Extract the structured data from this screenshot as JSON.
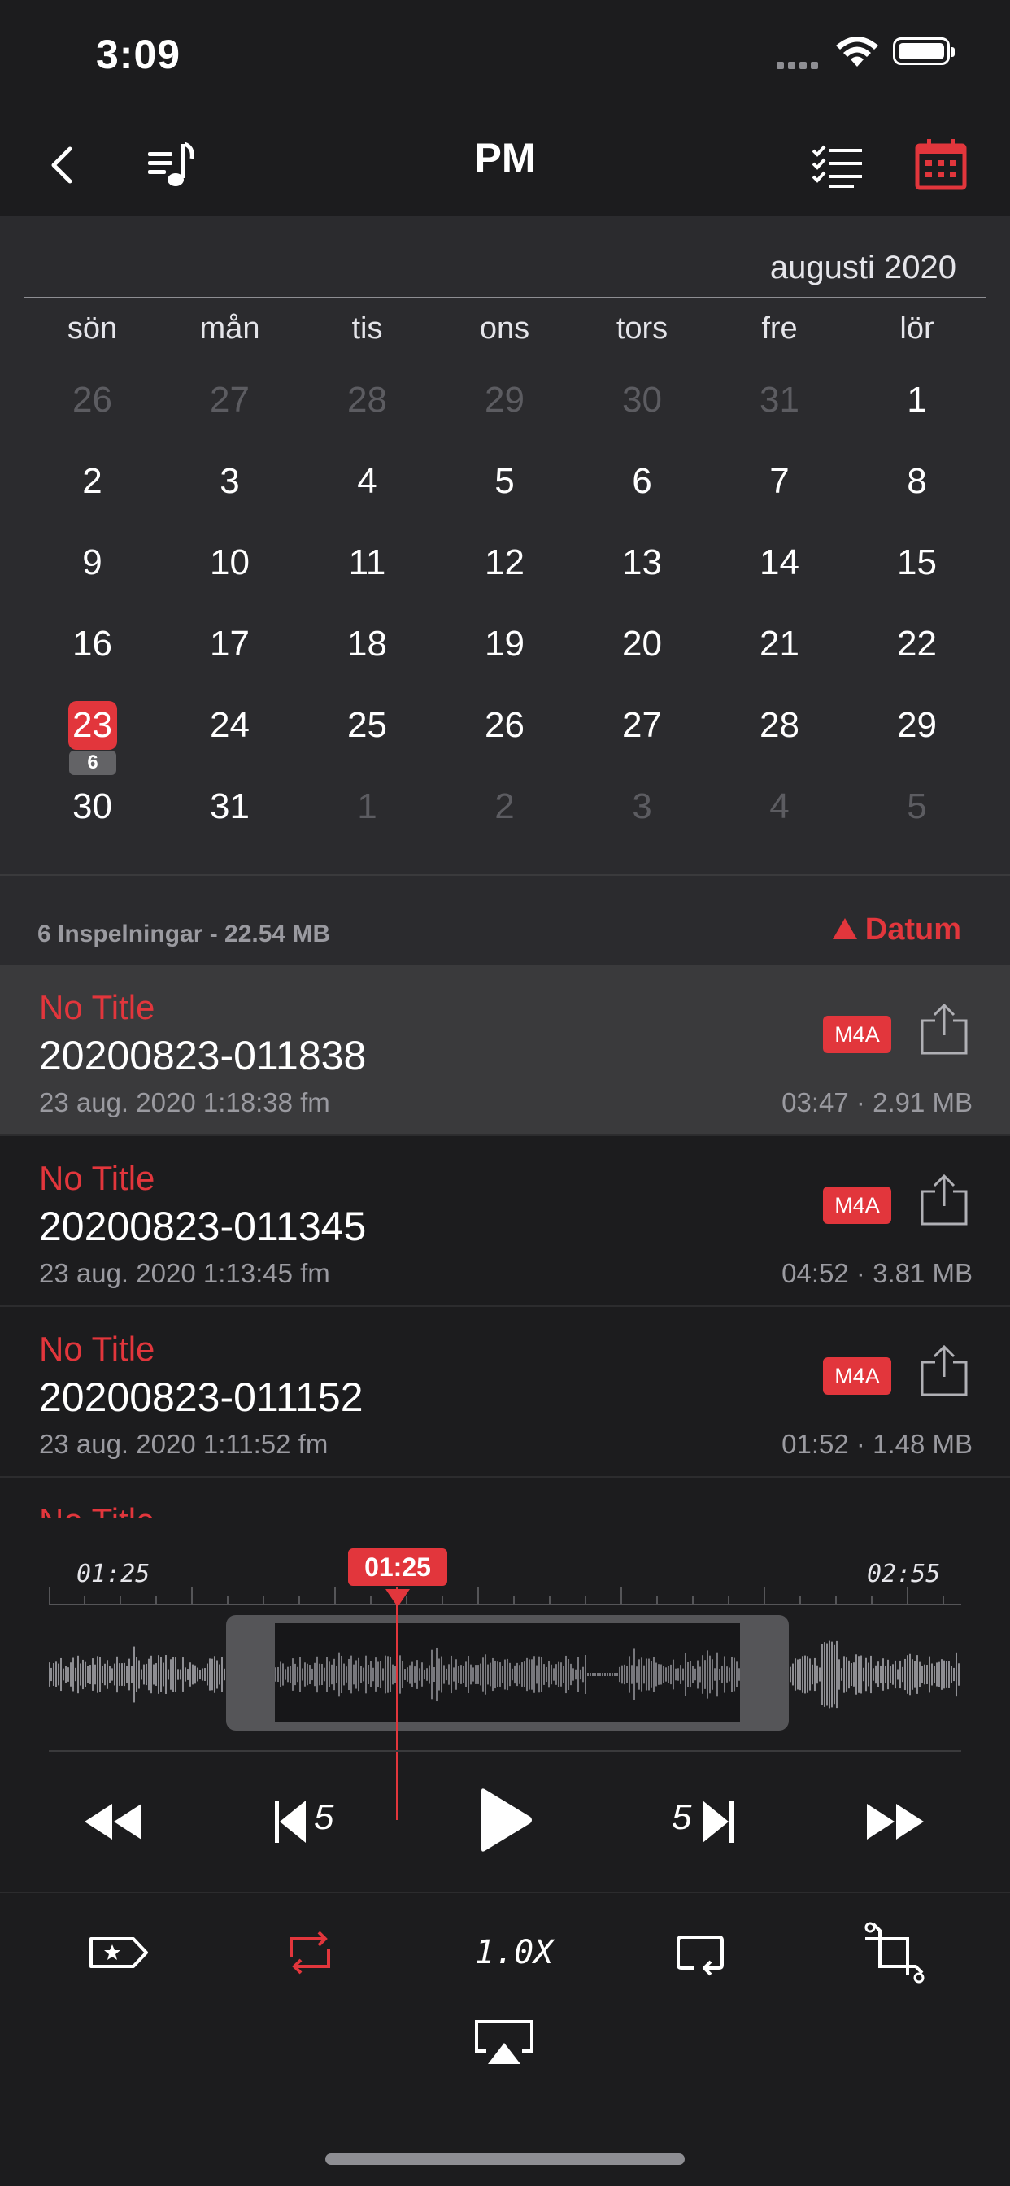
{
  "status_bar": {
    "time": "3:09"
  },
  "nav": {
    "title": "PM"
  },
  "calendar": {
    "month": "augusti 2020",
    "weekdays": [
      "sön",
      "mån",
      "tis",
      "ons",
      "tors",
      "fre",
      "lör"
    ],
    "weeks": [
      [
        "26",
        "27",
        "28",
        "29",
        "30",
        "31",
        "1"
      ],
      [
        "2",
        "3",
        "4",
        "5",
        "6",
        "7",
        "8"
      ],
      [
        "9",
        "10",
        "11",
        "12",
        "13",
        "14",
        "15"
      ],
      [
        "16",
        "17",
        "18",
        "19",
        "20",
        "21",
        "22"
      ],
      [
        "23",
        "24",
        "25",
        "26",
        "27",
        "28",
        "29"
      ],
      [
        "30",
        "31",
        "1",
        "2",
        "3",
        "4",
        "5"
      ]
    ],
    "selected_day": "23",
    "selected_count": "6"
  },
  "list": {
    "summary": "6 Inspelningar  -  22.54 MB",
    "sort_label": "Datum",
    "recordings": [
      {
        "title": "No Title",
        "name": "20200823-011838",
        "date": "23 aug. 2020 1:18:38 fm",
        "format": "M4A",
        "duration": "03:47",
        "size": "2.91 MB"
      },
      {
        "title": "No Title",
        "name": "20200823-011345",
        "date": "23 aug. 2020 1:13:45 fm",
        "format": "M4A",
        "duration": "04:52",
        "size": "3.81 MB"
      },
      {
        "title": "No Title",
        "name": "20200823-011152",
        "date": "23 aug. 2020 1:11:52 fm",
        "format": "M4A",
        "duration": "01:52",
        "size": "1.48 MB"
      }
    ],
    "partial_title": "No Title"
  },
  "player": {
    "start_time": "01:25",
    "current_time": "01:25",
    "end_time": "02:55",
    "skip_back_label": "5",
    "skip_forward_label": "5",
    "speed": "1.0X"
  },
  "colors": {
    "accent": "#e2363c",
    "background": "#1c1c1e",
    "calendar_bg": "#2b2b2e"
  }
}
